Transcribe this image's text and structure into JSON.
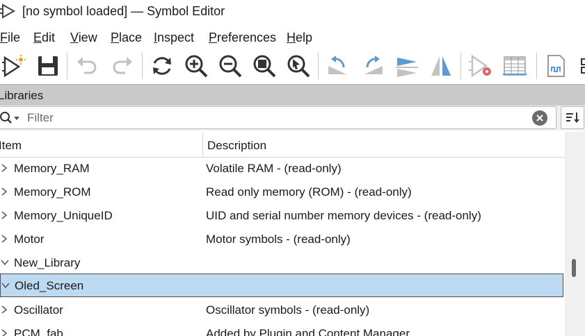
{
  "window": {
    "title": "[no symbol loaded] — Symbol Editor",
    "app_icon": "symbol-editor-icon"
  },
  "menubar": {
    "items": [
      {
        "label": "File",
        "mnemonic": "F"
      },
      {
        "label": "Edit",
        "mnemonic": "E"
      },
      {
        "label": "View",
        "mnemonic": "V"
      },
      {
        "label": "Place",
        "mnemonic": "P"
      },
      {
        "label": "Inspect",
        "mnemonic": "I"
      },
      {
        "label": "Preferences",
        "mnemonic": "P"
      },
      {
        "label": "Help",
        "mnemonic": "H"
      }
    ]
  },
  "toolbar": {
    "icons": [
      "new-symbol-icon",
      "save-icon",
      "undo-icon",
      "redo-icon",
      "refresh-icon",
      "zoom-in-icon",
      "zoom-out-icon",
      "zoom-fit-icon",
      "zoom-selection-icon",
      "rotate-ccw-icon",
      "rotate-cw-icon",
      "mirror-h-icon",
      "mirror-v-icon",
      "symbol-properties-icon",
      "pin-table-icon",
      "datasheet-icon",
      "more-icon"
    ]
  },
  "panel": {
    "title": "Libraries"
  },
  "filter": {
    "placeholder": "Filter",
    "value": ""
  },
  "tree": {
    "columns": {
      "item": "Item",
      "description": "Description"
    },
    "rows": [
      {
        "name": "Memory_RAM",
        "description": "Volatile RAM - (read-only)",
        "expanded": false,
        "selected": false
      },
      {
        "name": "Memory_ROM",
        "description": "Read only memory (ROM) - (read-only)",
        "expanded": false,
        "selected": false
      },
      {
        "name": "Memory_UniqueID",
        "description": "UID and serial number memory devices - (read-only)",
        "expanded": false,
        "selected": false
      },
      {
        "name": "Motor",
        "description": "Motor symbols - (read-only)",
        "expanded": false,
        "selected": false
      },
      {
        "name": "New_Library",
        "description": "",
        "expanded": true,
        "selected": false
      },
      {
        "name": "Oled_Screen",
        "description": "",
        "expanded": true,
        "selected": true
      },
      {
        "name": "Oscillator",
        "description": "Oscillator symbols - (read-only)",
        "expanded": false,
        "selected": false
      },
      {
        "name": "PCM_fab",
        "description": "Added by Plugin and Content Manager",
        "expanded": false,
        "selected": false
      }
    ]
  },
  "colors": {
    "selection": "#bcdaf1",
    "panel_header": "#c9c9c9",
    "accent_blue": "#5b9bd5",
    "accent_red": "#e06666"
  }
}
